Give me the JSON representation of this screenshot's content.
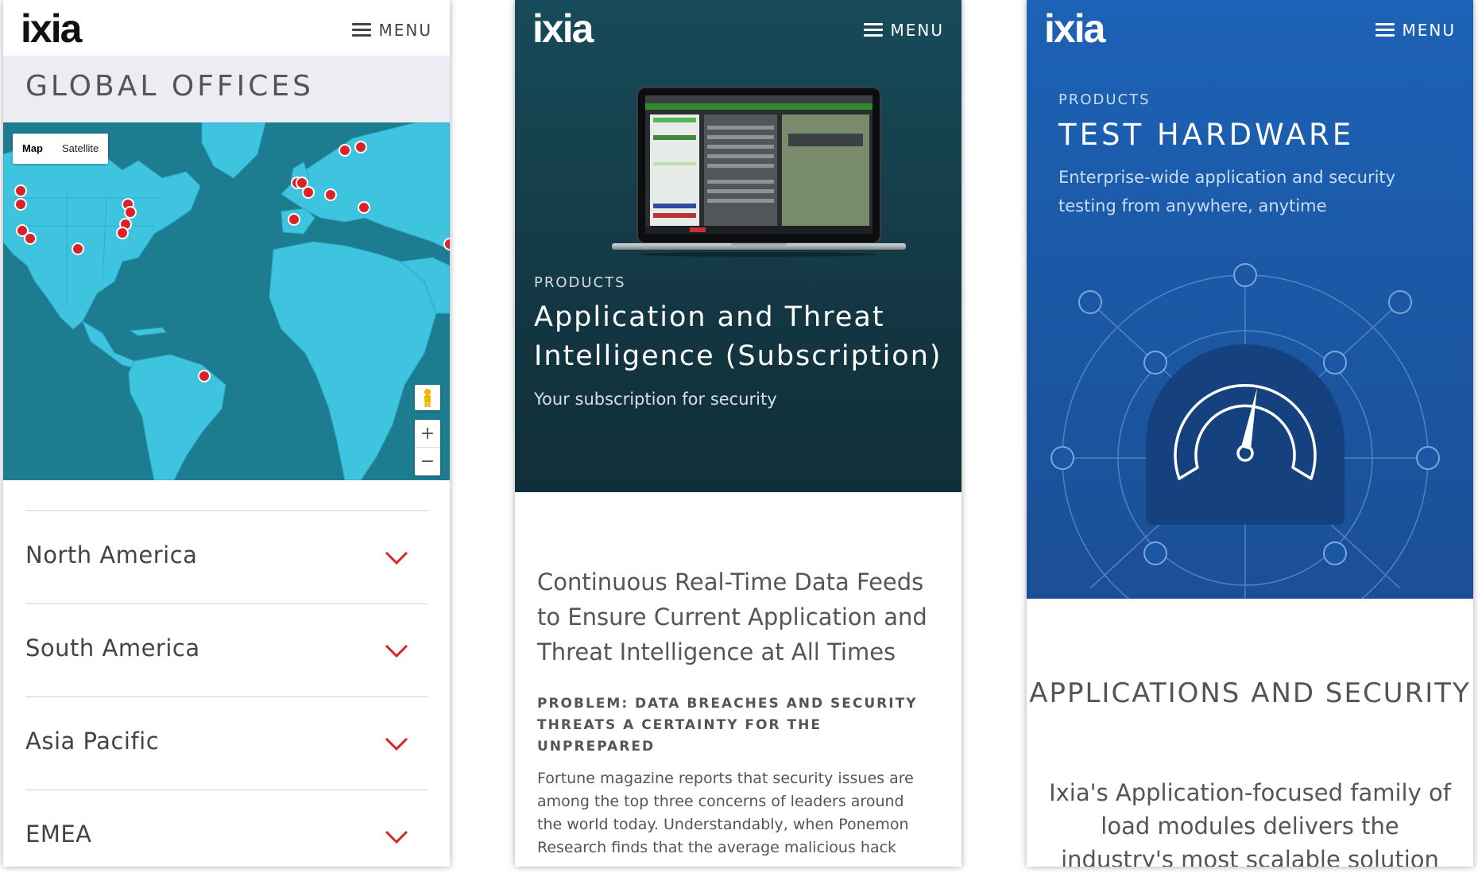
{
  "brand": {
    "logo_text": "ixia",
    "accent_red": "#d8232a"
  },
  "screens": [
    {
      "header": {
        "menu_label": "MENU"
      },
      "page_title": "GLOBAL OFFICES",
      "map": {
        "type_options": [
          "Map",
          "Satellite"
        ],
        "selected_type": "Map",
        "zoom_in": "+",
        "zoom_out": "−",
        "icons": [
          "pegman-icon",
          "zoom-in-icon",
          "zoom-out-icon",
          "office-marker-icon"
        ]
      },
      "regions": [
        {
          "label": "North America"
        },
        {
          "label": "South America"
        },
        {
          "label": "Asia Pacific"
        },
        {
          "label": "EMEA"
        }
      ]
    },
    {
      "header": {
        "menu_label": "MENU"
      },
      "eyebrow": "PRODUCTS",
      "title": "Application and Threat Intelligence (Subscription)",
      "subtitle": "Your subscription for security",
      "headline": "Continuous Real-Time Data Feeds to Ensure Current Application and Threat Intelligence at All Times",
      "section_heading": "PROBLEM: DATA BREACHES AND SECURITY THREATS A CERTAINTY FOR THE UNPREPARED",
      "body": "Fortune magazine reports that security issues are among the top three concerns of leaders around the world today. Understandably, when Ponemon Research finds that the average malicious hack"
    },
    {
      "header": {
        "menu_label": "MENU"
      },
      "eyebrow": "PRODUCTS",
      "title": "TEST HARDWARE",
      "subtitle": "Enterprise-wide application and security testing from anywhere, anytime",
      "section_heading": "APPLICATIONS AND SECURITY",
      "body": "Ixia's Application-focused family of load modules delivers the industry's most scalable solution"
    }
  ]
}
